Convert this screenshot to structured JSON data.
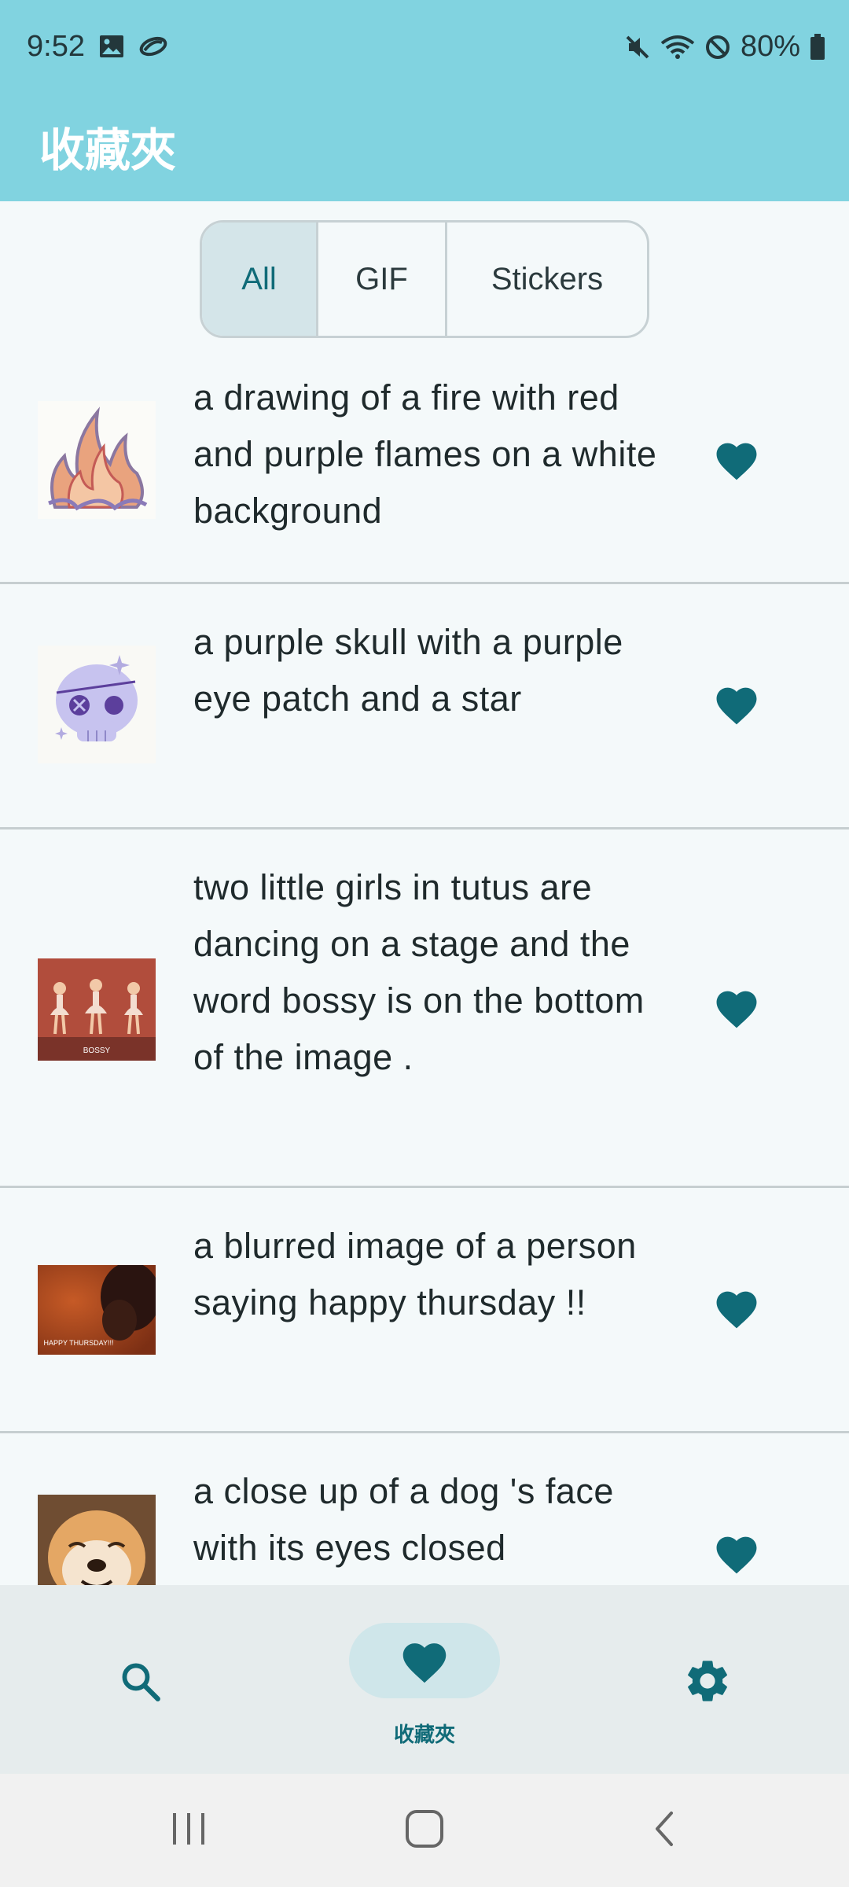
{
  "status_bar": {
    "time": "9:52",
    "battery": "80%",
    "icons": [
      "image-icon",
      "cloud-sync-icon",
      "mute-icon",
      "wifi-icon",
      "do-not-disturb-icon",
      "battery-icon"
    ]
  },
  "app_bar": {
    "title": "收藏夾"
  },
  "filter_tabs": [
    {
      "label": "All",
      "selected": true
    },
    {
      "label": "GIF",
      "selected": false
    },
    {
      "label": "Stickers",
      "selected": false
    }
  ],
  "favorites": [
    {
      "description": "a drawing of a fire with red and purple flames on a white background",
      "thumbnail": "fire-sticker-image",
      "favorited": true
    },
    {
      "description": "a purple skull with a purple eye patch and a star",
      "thumbnail": "skull-sticker-image",
      "favorited": true
    },
    {
      "description": "two little girls in tutus are dancing on a stage and the word bossy is on the bottom of the image .",
      "thumbnail": "dancing-girls-gif-image",
      "thumbnail_caption": "BOSSY",
      "favorited": true
    },
    {
      "description": "a blurred image of a person saying happy thursday !!",
      "thumbnail": "happy-thursday-gif-image",
      "thumbnail_caption": "HAPPY THURSDAY!!!",
      "favorited": true
    },
    {
      "description": "a close up of a dog 's face with its eyes closed",
      "thumbnail": "dog-face-gif-image",
      "favorited": true
    }
  ],
  "bottom_nav": {
    "items": [
      {
        "icon": "search-icon",
        "label": ""
      },
      {
        "icon": "heart-icon",
        "label": "收藏夾",
        "selected": true
      },
      {
        "icon": "gear-icon",
        "label": ""
      }
    ]
  },
  "colors": {
    "app_bar": "#81d3e0",
    "accent": "#106b78",
    "background": "#f4f9fa",
    "selected_tab": "#d4e5e9",
    "nav_bar": "#e6eced"
  }
}
